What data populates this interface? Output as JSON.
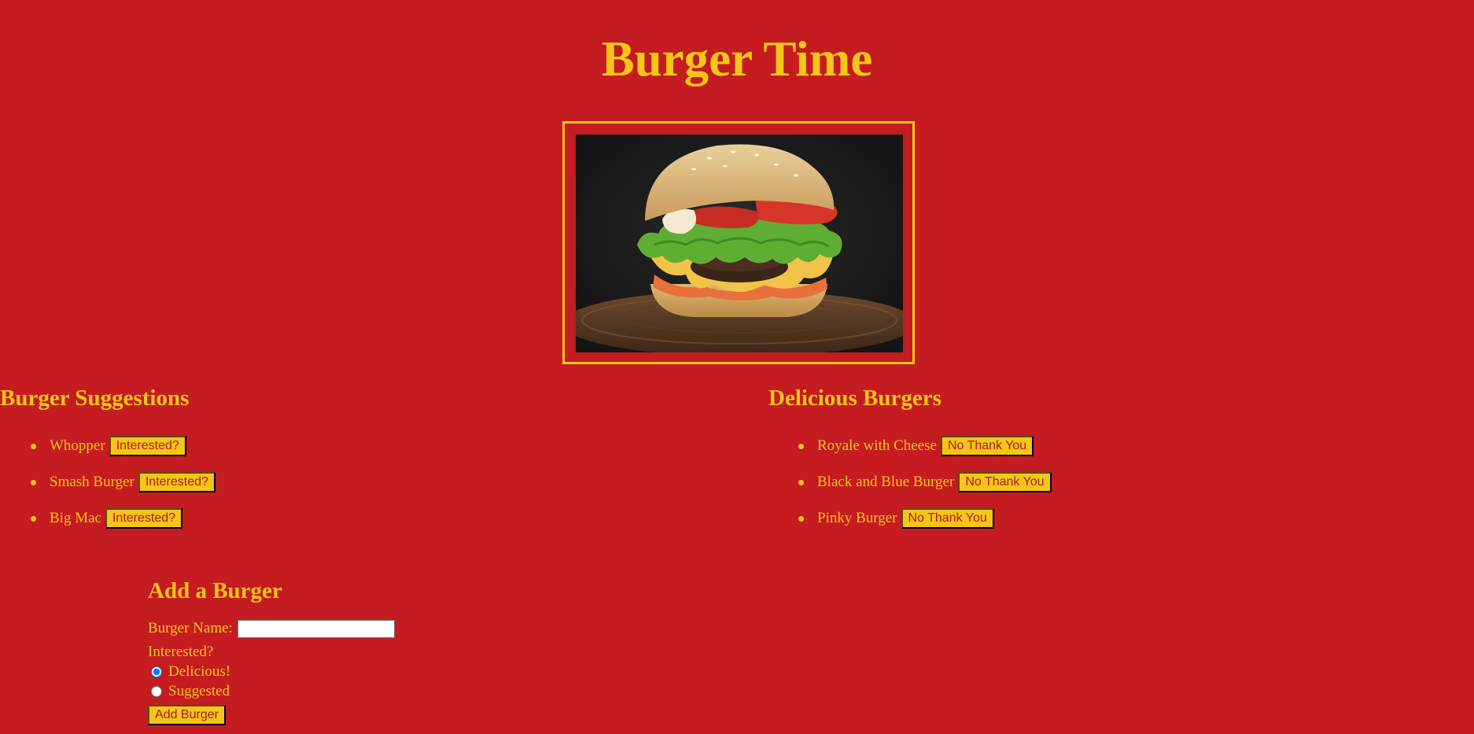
{
  "header": {
    "title": "Burger Time"
  },
  "hero": {
    "image_alt": "Cheeseburger with lettuce and tomato on a wooden board"
  },
  "suggestions": {
    "heading": "Burger Suggestions",
    "button_label": "Interested?",
    "items": [
      "Whopper",
      "Smash Burger",
      "Big Mac"
    ]
  },
  "delicious": {
    "heading": "Delicious Burgers",
    "button_label": "No Thank You",
    "items": [
      "Royale with Cheese",
      "Black and Blue Burger",
      "Pinky Burger"
    ]
  },
  "form": {
    "heading": "Add a Burger",
    "name_label": "Burger Name:",
    "name_value": "",
    "interested_label": "Interested?",
    "options": [
      {
        "label": "Delicious!",
        "checked": true
      },
      {
        "label": "Suggested",
        "checked": false
      }
    ],
    "submit_label": "Add Burger"
  },
  "colors": {
    "background": "#c41c20",
    "accent": "#f5c518"
  }
}
